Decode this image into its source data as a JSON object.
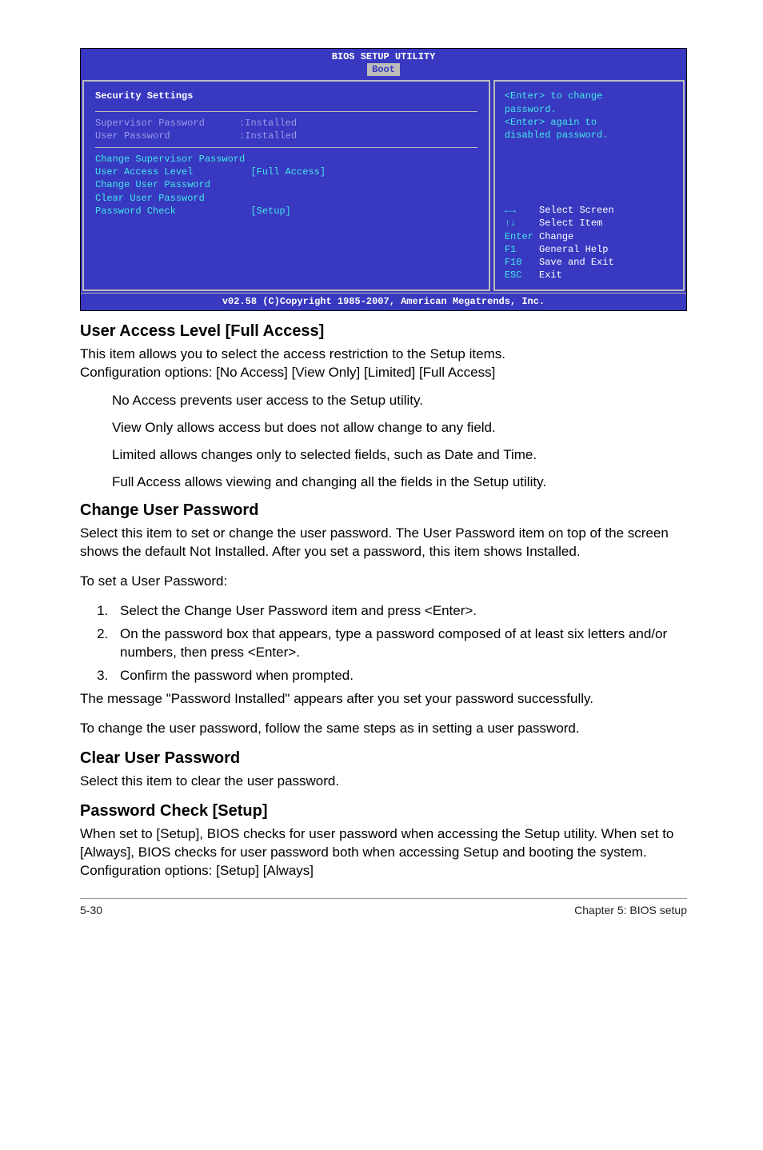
{
  "bios": {
    "title": "BIOS SETUP UTILITY",
    "tab": "Boot",
    "section_heading": "Security Settings",
    "supervisor_label": "Supervisor Password",
    "supervisor_value": ":Installed",
    "user_label": "User Password",
    "user_value": ":Installed",
    "opt_change_sup": "Change Supervisor Password",
    "opt_ual_label": "User Access Level",
    "opt_ual_value": "[Full Access]",
    "opt_change_user": "Change User Password",
    "opt_clear_user": "Clear User Password",
    "opt_pwcheck_label": "Password Check",
    "opt_pwcheck_value": "[Setup]",
    "help1": "<Enter> to change",
    "help2": "password.",
    "help3": "<Enter> again to",
    "help4": "disabled password.",
    "nav_select_screen": "Select Screen",
    "nav_select_item": "Select Item",
    "nav_enter": "Enter",
    "nav_change": "Change",
    "nav_f1": "F1",
    "nav_general_help": "General Help",
    "nav_f10": "F10",
    "nav_save_exit": "Save and Exit",
    "nav_esc": "ESC",
    "nav_exit": "Exit",
    "footer": "v02.58 (C)Copyright 1985-2007, American Megatrends, Inc."
  },
  "doc": {
    "h_ual": "User Access Level [Full Access]",
    "p_ual1": "This item allows you to select the access restriction to the Setup items.",
    "p_ual2": "Configuration options: [No Access] [View Only] [Limited] [Full Access]",
    "bullet_noaccess": "No Access prevents user access to the Setup utility.",
    "bullet_viewonly": "View Only allows access but does not allow change to any field.",
    "bullet_limited": "Limited allows changes only to selected fields, such as Date and Time.",
    "bullet_fullaccess": "Full Access allows viewing and changing all the fields in the Setup utility.",
    "h_cup": "Change User Password",
    "p_cup1": "Select this item to set or change the user password. The User Password item on top of the screen shows the default Not Installed. After you set a password, this item shows Installed.",
    "p_cup2": "To set a User Password:",
    "step1": "Select the Change User Password item and press <Enter>.",
    "step2": "On the password box that appears, type a password composed of at least six letters and/or numbers, then press <Enter>.",
    "step3": "Confirm the password when prompted.",
    "p_cup3": "The message \"Password Installed\" appears after you set your password successfully.",
    "p_cup4": "To change the user password, follow the same steps as in setting a user password.",
    "h_clear": "Clear User Password",
    "p_clear": "Select this item to clear the user password.",
    "h_pwcheck": "Password Check [Setup]",
    "p_pwcheck1": "When set to [Setup], BIOS checks for user password when accessing the Setup utility. When set to [Always], BIOS checks for user password both when accessing Setup and booting the system.",
    "p_pwcheck2": "Configuration options: [Setup] [Always]",
    "footer_left": "5-30",
    "footer_right": "Chapter 5: BIOS setup"
  }
}
